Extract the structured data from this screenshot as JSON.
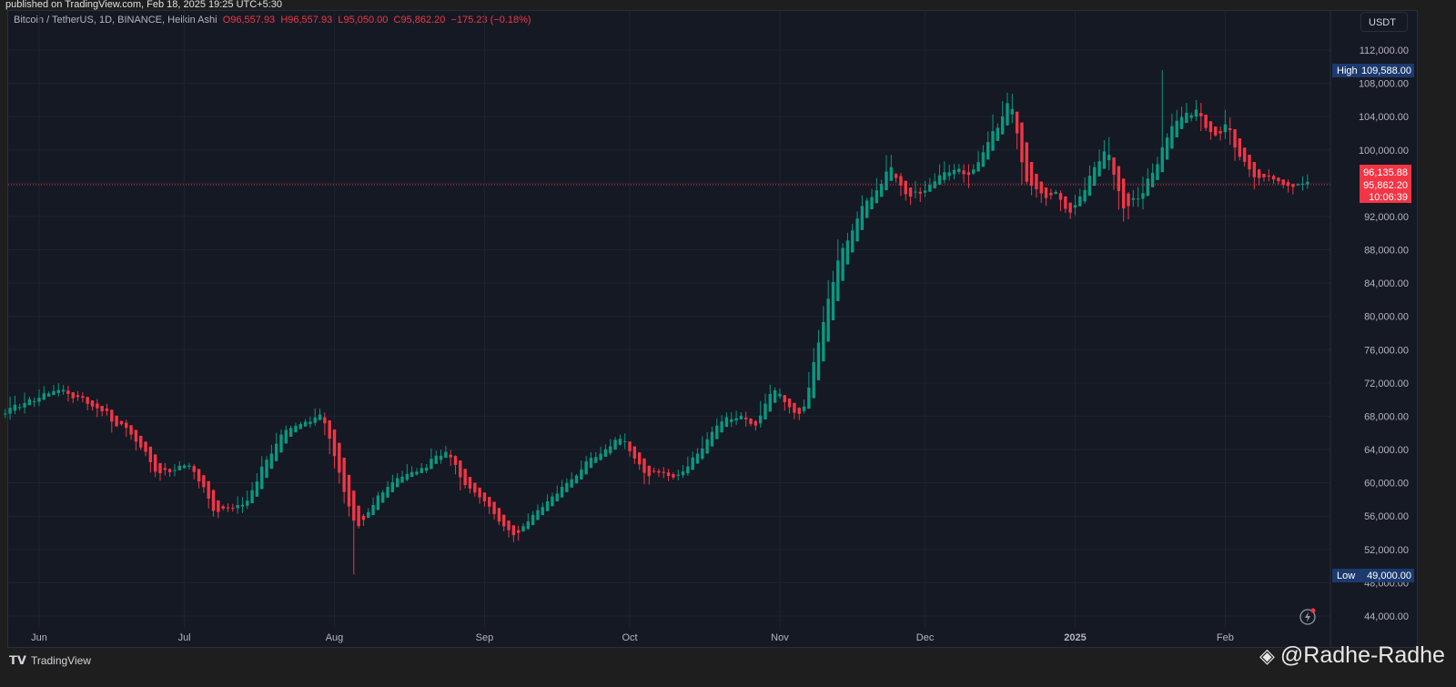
{
  "header": {
    "published": "published on TradingView.com, Feb 18, 2025 19:25 UTC+5:30"
  },
  "legend": {
    "symbol": "Bitcoin / TetherUS, 1D, BINANCE, Heikin Ashi",
    "open": "O96,557.93",
    "high": "H96,557.93",
    "low": "L95,050.00",
    "close": "C95,862.20",
    "change": "−175.23 (−0.18%)"
  },
  "currency": "USDT",
  "markers": {
    "high_label": "High",
    "high_value": "109,588.00",
    "low_label": "Low",
    "low_value": "49,000.00",
    "last_a": "96,135.88",
    "last_b": "95,862.20",
    "countdown": "10:06:39"
  },
  "footer": {
    "brand": "TradingView",
    "watermark": "@Radhe-Radhe"
  },
  "colors": {
    "up": "#089981",
    "down": "#f23645",
    "bg": "#151924"
  },
  "chart_data": {
    "type": "candlestick",
    "title": "Bitcoin / TetherUS, 1D, BINANCE, Heikin Ashi",
    "ylim": [
      42000,
      114000
    ],
    "yticks": [
      112000,
      108000,
      104000,
      100000,
      96000,
      92000,
      88000,
      84000,
      80000,
      76000,
      72000,
      68000,
      64000,
      60000,
      56000,
      52000,
      48000,
      44000
    ],
    "ytick_labels": [
      "112,000.00",
      "108,000.00",
      "104,000.00",
      "100,000.00",
      "96,000.00",
      "92,000.00",
      "88,000.00",
      "84,000.00",
      "80,000.00",
      "76,000.00",
      "72,000.00",
      "68,000.00",
      "64,000.00",
      "60,000.00",
      "56,000.00",
      "52,000.00",
      "48,000.00",
      "44,000.00"
    ],
    "xticks": [
      {
        "label": "Jun",
        "day": 0
      },
      {
        "label": "Jul",
        "day": 30
      },
      {
        "label": "Aug",
        "day": 61
      },
      {
        "label": "Sep",
        "day": 92
      },
      {
        "label": "Oct",
        "day": 122
      },
      {
        "label": "Nov",
        "day": 153
      },
      {
        "label": "Dec",
        "day": 183
      },
      {
        "label": "2025",
        "day": 214
      },
      {
        "label": "Feb",
        "day": 245
      }
    ],
    "x_unit": "days since 2024-06-01",
    "last_price": 95862.2,
    "high": 109588,
    "low": 49000,
    "close_path": [
      [
        -7,
        69000
      ],
      [
        4,
        71000
      ],
      [
        10,
        69500
      ],
      [
        18,
        66000
      ],
      [
        24,
        61000
      ],
      [
        30,
        62500
      ],
      [
        36,
        56500
      ],
      [
        42,
        57500
      ],
      [
        50,
        66500
      ],
      [
        58,
        68000
      ],
      [
        65,
        54000
      ],
      [
        70,
        59000
      ],
      [
        84,
        64000
      ],
      [
        88,
        59000
      ],
      [
        98,
        54000
      ],
      [
        112,
        62000
      ],
      [
        120,
        65500
      ],
      [
        125,
        61000
      ],
      [
        132,
        61000
      ],
      [
        142,
        68000
      ],
      [
        148,
        67000
      ],
      [
        151,
        71500
      ],
      [
        156,
        68000
      ],
      [
        158,
        70000
      ],
      [
        165,
        88000
      ],
      [
        175,
        98000
      ],
      [
        179,
        94000
      ],
      [
        188,
        98000
      ],
      [
        193,
        97000
      ],
      [
        200,
        106000
      ],
      [
        203,
        97000
      ],
      [
        213,
        93000
      ],
      [
        220,
        100000
      ],
      [
        224,
        93000
      ],
      [
        227,
        94000
      ],
      [
        234,
        104000
      ],
      [
        239,
        104500
      ],
      [
        242,
        102000
      ],
      [
        245,
        104000
      ],
      [
        248,
        98000
      ],
      [
        252,
        96000
      ],
      [
        262,
        95862
      ]
    ]
  }
}
